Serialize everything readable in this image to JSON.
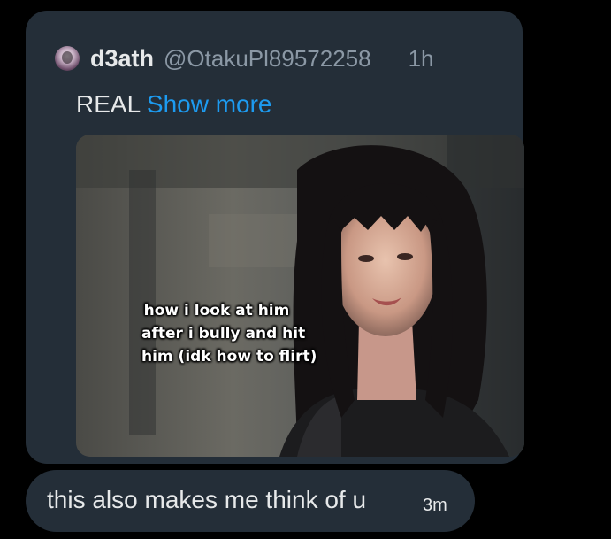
{
  "quoted_post": {
    "display_name": "d3ath",
    "handle": "@OtakuPl89572258",
    "time": "1h",
    "text": "REAL",
    "show_more_label": "Show more",
    "media": {
      "caption_lines": [
        "how i look at him",
        "after i bully and hit",
        "him (idk how to flirt)"
      ]
    }
  },
  "reply": {
    "text": "this also makes me think of u",
    "time": "3m"
  },
  "colors": {
    "background": "#000000",
    "bubble": "#242e38",
    "link": "#1d9bf0",
    "secondary_text": "#8b98a5",
    "primary_text": "#e7e9ea"
  }
}
